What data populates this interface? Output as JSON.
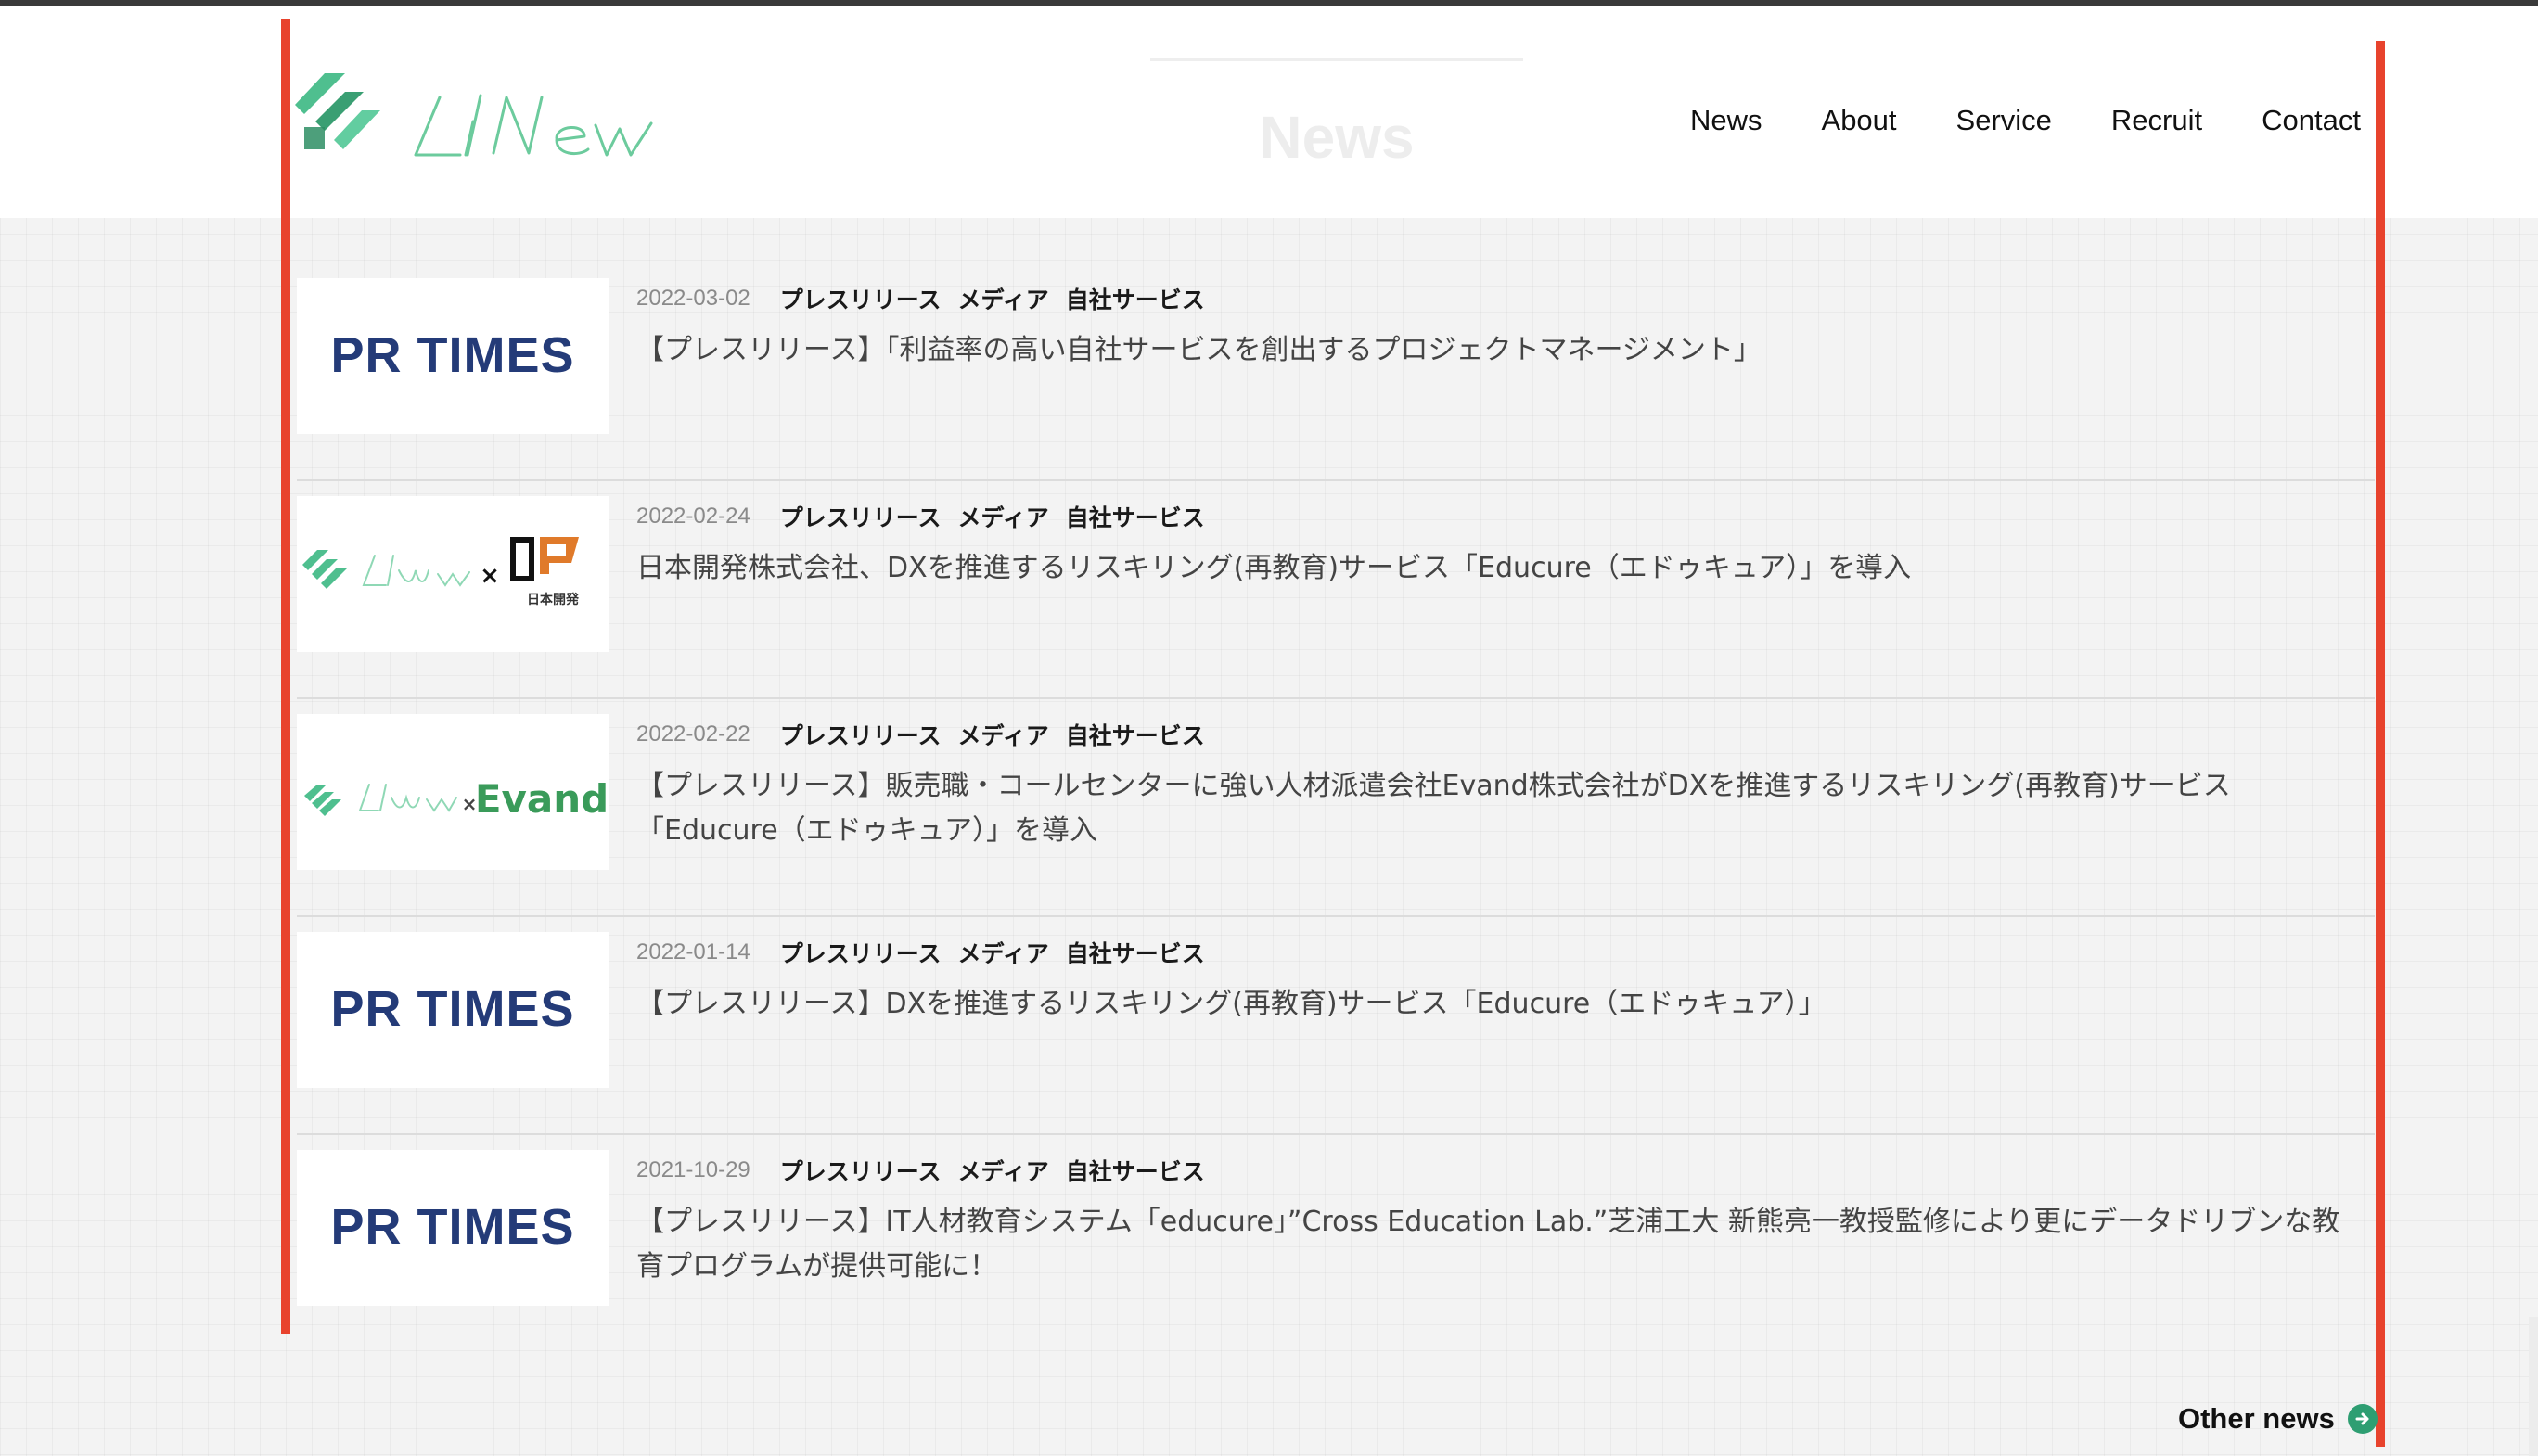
{
  "header": {
    "logo_text": "Lilnew",
    "section_title": "News",
    "nav": [
      "News",
      "About",
      "Service",
      "Recruit",
      "Contact"
    ]
  },
  "colors": {
    "accent_red": "#e8432d",
    "brand_green": "#4fbf8f",
    "pr_times_navy": "#243b78"
  },
  "news": [
    {
      "date": "2022-03-02",
      "tags": [
        "プレスリリース",
        "メディア",
        "自社サービス"
      ],
      "title": "【プレスリリース】「利益率の高い自社サービスを創出するプロジェクトマネージメント」",
      "thumb": "PR TIMES"
    },
    {
      "date": "2022-02-24",
      "tags": [
        "プレスリリース",
        "メディア",
        "自社サービス"
      ],
      "title": "日本開発株式会社、DXを推進するリスキリング(再教育)サービス「Educure（エドゥキュア）」を導入",
      "thumb": "日本開発"
    },
    {
      "date": "2022-02-22",
      "tags": [
        "プレスリリース",
        "メディア",
        "自社サービス"
      ],
      "title": "【プレスリリース】販売職・コールセンターに強い人材派遣会社Evand株式会社がDXを推進するリスキリング(再教育)サービス「Educure（エドゥキュア）」を導入",
      "thumb": "Evand"
    },
    {
      "date": "2022-01-14",
      "tags": [
        "プレスリリース",
        "メディア",
        "自社サービス"
      ],
      "title": "【プレスリリース】DXを推進するリスキリング(再教育)サービス「Educure（エドゥキュア）」",
      "thumb": "PR TIMES"
    },
    {
      "date": "2021-10-29",
      "tags": [
        "プレスリリース",
        "メディア",
        "自社サービス"
      ],
      "title": "【プレスリリース】IT人材教育システム「educure」”Cross Education Lab.”芝浦工大 新熊亮一教授監修により更にデータドリブンな教育プログラムが提供可能に！",
      "thumb": "PR TIMES"
    }
  ],
  "other_news_label": "Other news"
}
